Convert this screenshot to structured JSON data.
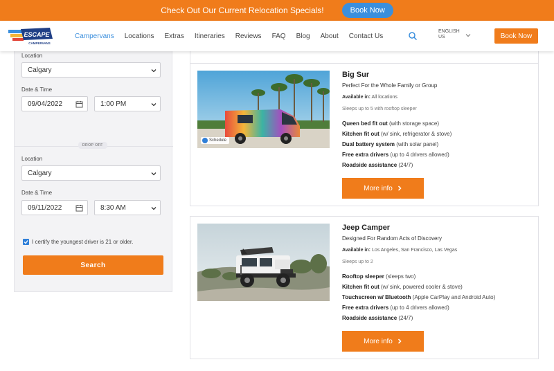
{
  "promo": {
    "text": "Check Out Our Current Relocation Specials!",
    "button": "Book Now"
  },
  "header": {
    "logo_text": "ESCAPE",
    "logo_sub": "CAMPERVANS",
    "nav": [
      "Campervans",
      "Locations",
      "Extras",
      "Itineraries",
      "Reviews",
      "FAQ",
      "Blog",
      "About",
      "Contact Us"
    ],
    "language_line1": "ENGLISH",
    "language_line2": "US",
    "book_button": "Book Now",
    "colors": {
      "accent": "#f07c1b",
      "link": "#3b8fdd"
    }
  },
  "form": {
    "pickup": {
      "location_label": "Location",
      "location_value": "Calgary",
      "datetime_label": "Date & Time",
      "date": "09/04/2022",
      "time": "1:00 PM"
    },
    "dropoff_badge": "DROP OFF",
    "dropoff": {
      "location_label": "Location",
      "location_value": "Calgary",
      "datetime_label": "Date & Time",
      "date": "09/11/2022",
      "time": "8:30 AM"
    },
    "certify": "I certify the youngest driver is 21 or older.",
    "search_button": "Search"
  },
  "results": [
    {
      "title": "Big Sur",
      "subtitle": "Perfect For the Whole Family or Group",
      "available_label": "Available in:",
      "available_value": "All locations",
      "sleeps": "Sleeps up to 5 with rooftop sleeper",
      "schedule": "Schedule",
      "features": [
        {
          "name": "Queen bed fit out",
          "detail": "(with storage space)"
        },
        {
          "name": "Kitchen fit out",
          "detail": "(w/ sink, refrigerator & stove)"
        },
        {
          "name": "Dual battery system",
          "detail": "(with solar panel)"
        },
        {
          "name": "Free extra drivers",
          "detail": "(up to 4 drivers allowed)"
        },
        {
          "name": "Roadside assistance",
          "detail": "(24/7)"
        }
      ],
      "button": "More info"
    },
    {
      "title": "Jeep Camper",
      "subtitle": "Designed For Random Acts of Discovery",
      "available_label": "Available in:",
      "available_value": "Los Angeles, San Francisco, Las Vegas",
      "sleeps": "Sleeps up to 2",
      "features": [
        {
          "name": "Rooftop sleeper",
          "detail": "(sleeps two)"
        },
        {
          "name": "Kitchen fit out",
          "detail": "(w/ sink, powered cooler & stove)"
        },
        {
          "name": "Touchscreen w/ Bluetooth",
          "detail": "(Apple CarPlay and Android Auto)"
        },
        {
          "name": "Free extra drivers",
          "detail": "(up to 4 drivers allowed)"
        },
        {
          "name": "Roadside assistance",
          "detail": "(24/7)"
        }
      ],
      "button": "More info"
    }
  ]
}
